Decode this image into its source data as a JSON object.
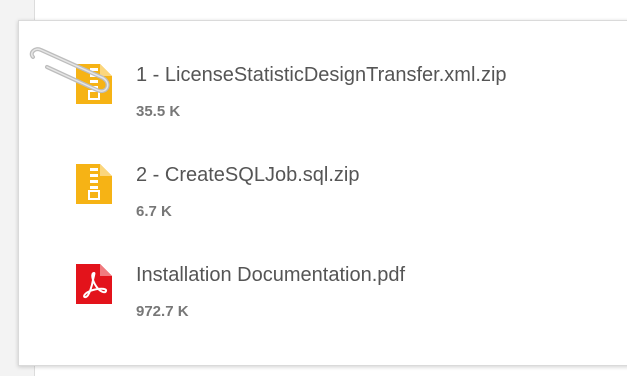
{
  "attachments": {
    "files": [
      {
        "name": "1 - LicenseStatisticDesignTransfer.xml.zip",
        "size": "35.5 K",
        "icon": "zip-file-icon"
      },
      {
        "name": "2 - CreateSQLJob.sql.zip",
        "size": "6.7 K",
        "icon": "zip-file-icon"
      },
      {
        "name": "Installation Documentation.pdf",
        "size": "972.7 K",
        "icon": "pdf-file-icon"
      }
    ]
  },
  "colors": {
    "zip_icon": "#f6b315",
    "pdf_icon": "#e3131b",
    "text": "#555555",
    "size_text": "#777777"
  }
}
